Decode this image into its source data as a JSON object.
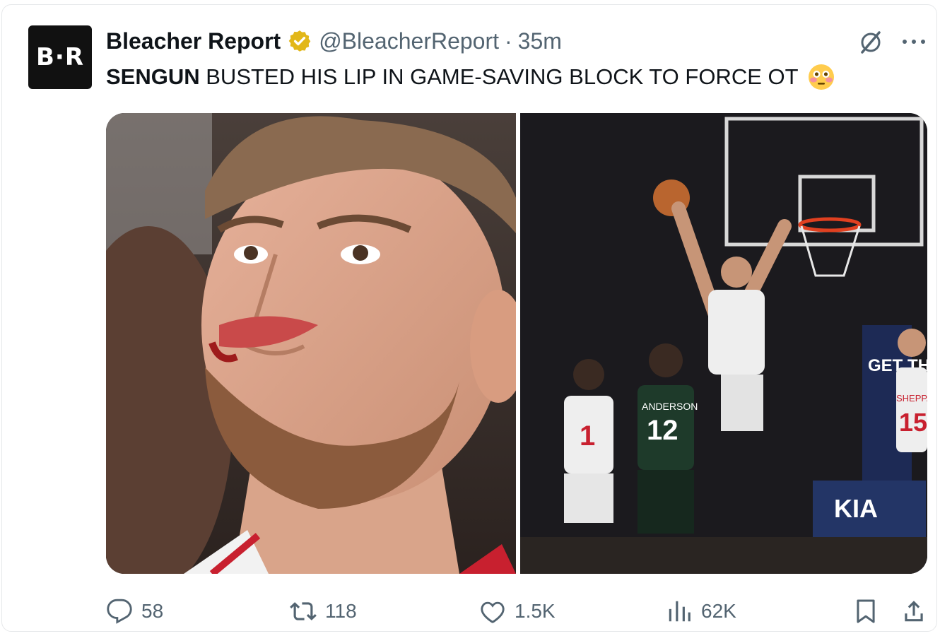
{
  "account": {
    "avatar_text": "B·R",
    "name": "Bleacher Report",
    "verified_icon": "gold-check-badge-icon",
    "handle": "@BleacherReport",
    "separator": "·",
    "time": "35m"
  },
  "tweet": {
    "bold_text": "SENGUN",
    "text": " BUSTED HIS LIP IN GAME-SAVING BLOCK TO FORCE OT",
    "emoji": "flushed-face-emoji"
  },
  "media": {
    "left_image": "close-up of player with bleeding lip",
    "right_image": "player blocking shot at basket",
    "jersey_numbers": [
      "1",
      "12",
      "15"
    ],
    "jersey_names": [
      "ANDERSON",
      "SHEPPARD"
    ],
    "banner_text": "GET TH",
    "sponsor_text": "KIA"
  },
  "actions": {
    "replies": "58",
    "reposts": "118",
    "likes": "1.5K",
    "views": "62K"
  }
}
